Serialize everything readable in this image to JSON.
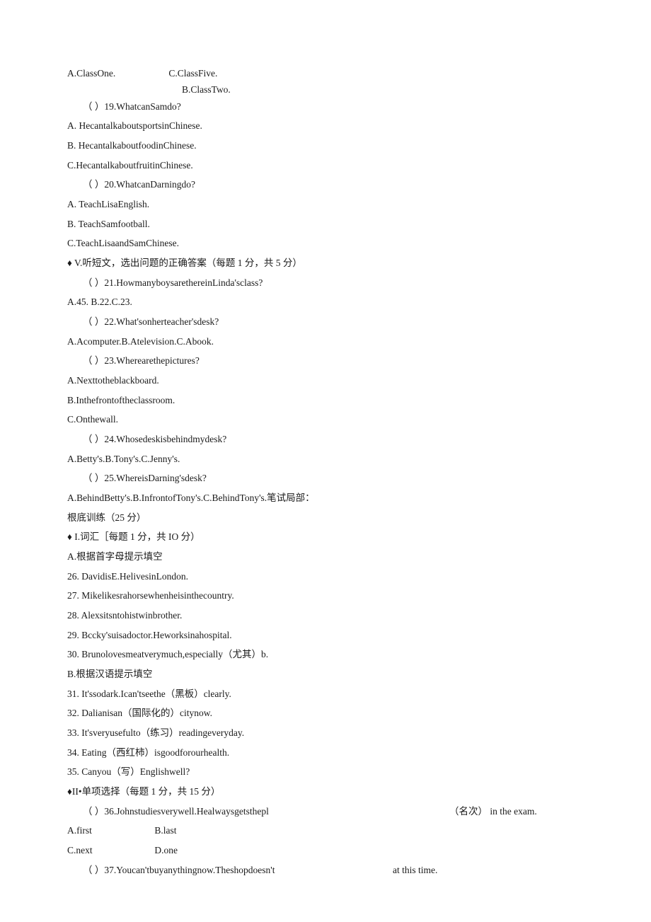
{
  "q18": {
    "a": "A.ClassOne.",
    "b": "B.ClassTwo.",
    "c": "C.ClassFive."
  },
  "q19": {
    "stem": "（  ）19.WhatcanSamdo?",
    "a": "A.   HecantalkaboutsportsinChinese.",
    "b": "B.   HecantalkaboutfoodinChinese.",
    "c": "C.HecantalkaboutfruitinChinese."
  },
  "q20": {
    "stem": "（  ）20.WhatcanDarningdo?",
    "a": "A.   TeachLisaEnglish.",
    "b": "B.   TeachSamfootball.",
    "c": "C.TeachLisaandSamChinese."
  },
  "sec5": "♦    V.听短文，选出问题的正确答案（每题 1 分，共 5 分）",
  "q21": {
    "stem": "（  ）21.HowmanyboysarethereinLinda'sclass?",
    "opts": "A.45.                        B.22.C.23."
  },
  "q22": {
    "stem": "（  ）22.What'sonherteacher'sdesk?",
    "opts": "A.Acomputer.B.Atelevision.C.Abook."
  },
  "q23": {
    "stem": "（  ）23.Wherearethepictures?",
    "a": "A.Nexttotheblackboard.",
    "b": "B.Inthefrontoftheclassroom.",
    "c": "C.Onthewall."
  },
  "q24": {
    "stem": "（  ）24.Whosedeskisbehindmydesk?",
    "opts": "A.Betty's.B.Tony's.C.Jenny's."
  },
  "q25": {
    "stem": "（  ）25.WhereisDarning'sdesk?",
    "opts": "A.BehindBetty's.B.InfrontofTony's.C.BehindTony's.笔试局部："
  },
  "basic": "根底训练（25 分）",
  "sec_i": "♦    I.词汇［每题 1 分，共 IO 分）",
  "partA": "A.根据首字母提示填空",
  "i26": "26.   DavidisE.HelivesinLondon.",
  "i27": "27.   Mikelikesrahorsewhenheisinthecountry.",
  "i28": "28.   Alexsitsntohistwinbrother.",
  "i29": "29.   Bccky'suisadoctor.Heworksinahospital.",
  "i30": "30.   Brunolovesmeatverymuch,especially（尤其）b.",
  "partB": "B.根据汉语提示填空",
  "i31": "31.   It'ssodark.Ican'tseethe（黑板）clearly.",
  "i32": "32.   Dalianisan（国际化的）citynow.",
  "i33": "33.   It'sveryusefulto（练习）readingeveryday.",
  "i34": "34.   Eating（西红柿）isgoodforourhealth.",
  "i35": "35.   Canyou（写）Englishwell?",
  "sec_ii": "♦II•单项选择（每题 1 分，共 15 分）",
  "q36": {
    "stem": "（  ）36.Johnstudiesverywell.Healwaysgetsthepl",
    "tail": "（名次）   in the exam.",
    "a": "A.first",
    "b": "B.last",
    "c": "C.next",
    "d": "D.one"
  },
  "q37": {
    "stem": "（  ）37.Youcan'tbuyanythingnow.Theshopdoesn't",
    "tail": "at this time."
  }
}
